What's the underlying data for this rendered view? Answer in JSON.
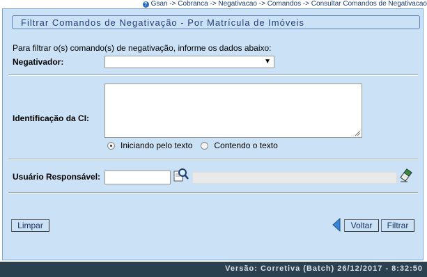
{
  "breadcrumb": {
    "icon": "help-icon",
    "text": "Gsan -> Cobranca -> Negativacao -> Comandos -> Consultar Comandos de Negativacao"
  },
  "title": "Filtrar Comandos de Negativação - Por Matrícula de Imóveis",
  "intro": "Para filtrar o(s) comando(s) de negativação, informe os dados abaixo:",
  "negativador": {
    "label": "Negativador:",
    "selected": ""
  },
  "ci": {
    "label": "Identificação da CI:",
    "value": "",
    "options": [
      {
        "label": "Iniciando pelo texto",
        "checked": true
      },
      {
        "label": "Contendo o texto",
        "checked": false
      }
    ]
  },
  "usuario": {
    "label": "Usuário Responsável:",
    "code": "",
    "name": "",
    "search_icon": "magnifier-search-icon",
    "clear_icon": "eraser-icon"
  },
  "buttons": {
    "limpar": "Limpar",
    "voltar": "Voltar",
    "filtrar": "Filtrar",
    "back_icon": "back-arrow-icon"
  },
  "footer": "Versão: Corretiva (Batch) 26/12/2017 - 8:32:50",
  "colors": {
    "panel_bg": "#cbe1f6",
    "title_text": "#1f3f7a",
    "footer_bg": "#2b4150",
    "footer_text": "#d7e0e8"
  }
}
